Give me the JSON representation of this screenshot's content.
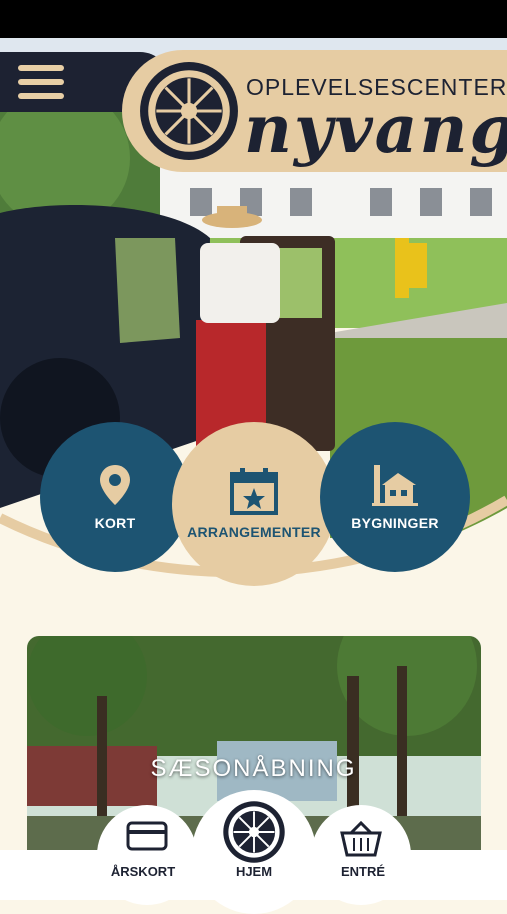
{
  "header": {
    "logo_top": "OPLEVELSESCENTER",
    "logo_main": "nyvang"
  },
  "quick_links": [
    {
      "label": "KORT",
      "icon": "map-pin-icon"
    },
    {
      "label": "ARRANGEMENTER",
      "icon": "calendar-icon"
    },
    {
      "label": "BYGNINGER",
      "icon": "buildings-icon"
    }
  ],
  "feature_card": {
    "title": "SÆSONÅBNING"
  },
  "bottom_nav": [
    {
      "label": "ÅRSKORT",
      "icon": "card-icon"
    },
    {
      "label": "HJEM",
      "icon": "wheel-logo-icon"
    },
    {
      "label": "ENTRÉ",
      "icon": "basket-icon"
    }
  ],
  "colors": {
    "navy": "#1d2232",
    "blue": "#1d5472",
    "sand": "#e6cca3",
    "cream": "#fbf6e8"
  }
}
